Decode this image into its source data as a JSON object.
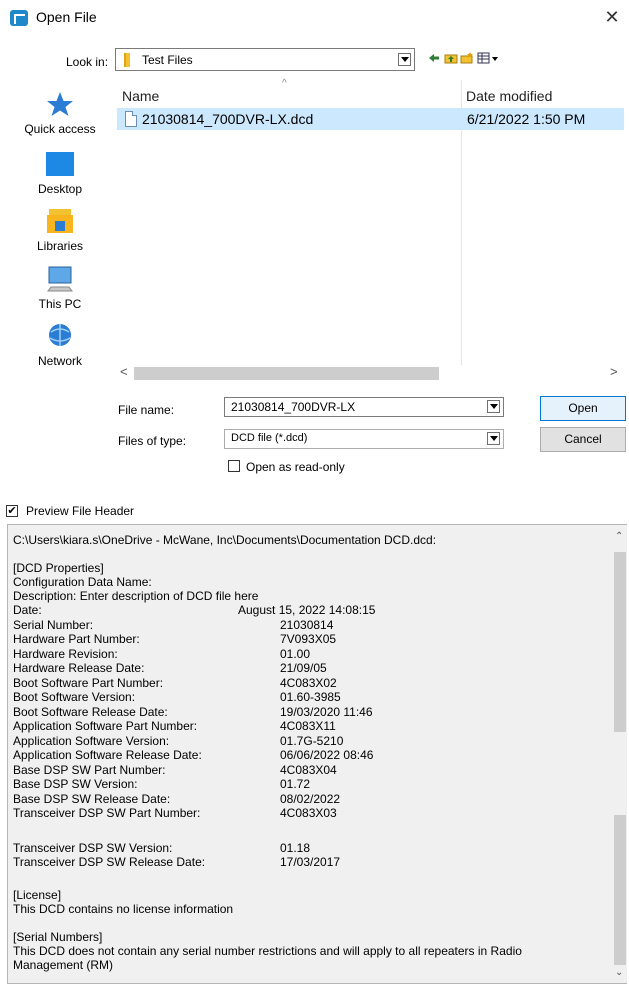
{
  "window": {
    "title": "Open File",
    "close_glyph": "✕"
  },
  "look_in": {
    "label": "Look in:",
    "value": "Test Files"
  },
  "places": [
    {
      "label": "Quick access",
      "icon": "star-icon"
    },
    {
      "label": "Desktop",
      "icon": "desktop-icon"
    },
    {
      "label": "Libraries",
      "icon": "libraries-icon"
    },
    {
      "label": "This PC",
      "icon": "computer-icon"
    },
    {
      "label": "Network",
      "icon": "network-icon"
    }
  ],
  "file_list": {
    "columns": {
      "name": "Name",
      "date": "Date modified"
    },
    "rows": [
      {
        "name": "21030814_700DVR-LX.dcd",
        "date": "6/21/2022 1:50 PM"
      }
    ]
  },
  "form": {
    "file_name_label": "File name:",
    "file_name_value": "21030814_700DVR-LX",
    "file_type_label": "Files of type:",
    "file_type_value": "DCD file (*.dcd)",
    "open_button": "Open",
    "cancel_button": "Cancel",
    "readonly_label": "Open as read-only"
  },
  "preview": {
    "checkbox_label": "Preview File Header",
    "checked_glyph": "✔",
    "path": "C:\\Users\\kiara.s\\OneDrive - McWane, Inc\\Documents\\Documentation DCD.dcd:",
    "section_properties": "[DCD Properties]",
    "config_name": "Configuration Data Name:",
    "description": "Description: Enter description of DCD file here",
    "fields": [
      {
        "label": "Date:",
        "value": "August 15, 2022 14:08:15"
      },
      {
        "label": "Serial Number:",
        "value": "21030814"
      },
      {
        "label": "Hardware Part Number:",
        "value": "7V093X05"
      },
      {
        "label": "Hardware Revision:",
        "value": "01.00"
      },
      {
        "label": "Hardware Release Date:",
        "value": "21/09/05"
      },
      {
        "label": "Boot Software Part Number:",
        "value": "4C083X02"
      },
      {
        "label": "Boot Software Version:",
        "value": "01.60-3985"
      },
      {
        "label": "Boot Software Release Date:",
        "value": "19/03/2020 11:46"
      },
      {
        "label": "Application Software Part Number:",
        "value": "4C083X11"
      },
      {
        "label": "Application Software Version:",
        "value": "01.7G-5210"
      },
      {
        "label": "Application Software Release Date:",
        "value": "06/06/2022 08:46"
      },
      {
        "label": "Base DSP SW Part Number:",
        "value": "4C083X04"
      },
      {
        "label": "Base DSP SW Version:",
        "value": "01.72"
      },
      {
        "label": "Base DSP SW Release Date:",
        "value": "08/02/2022"
      },
      {
        "label": "Transceiver DSP SW Part Number:",
        "value": "4C083X03"
      },
      {
        "label": "Transceiver DSP SW Version:",
        "value": "01.18"
      },
      {
        "label": "Transceiver DSP SW Release Date:",
        "value": "17/03/2017"
      }
    ],
    "section_license": "[License]",
    "license_text": "This DCD contains no license information",
    "section_serials": "[Serial Numbers]",
    "serials_text_1": "This DCD does not contain any serial number restrictions and will apply to all repeaters in Radio",
    "serials_text_2": "Management (RM)"
  }
}
